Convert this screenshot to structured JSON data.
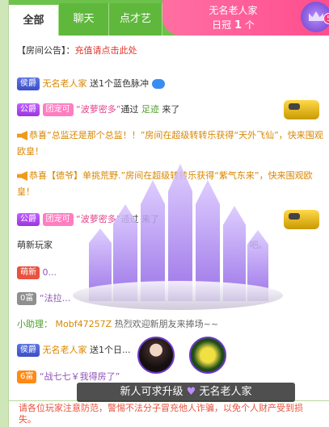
{
  "tabs": [
    "全部",
    "聊天",
    "点才艺"
  ],
  "active_tab": 0,
  "top_box": {
    "name": "无名老人家",
    "rank_prefix": "日冠",
    "rank_num": "1",
    "rank_suffix": "个",
    "level": "5"
  },
  "notice": {
    "label": "【房间公告】：",
    "link": "充值请点击此处"
  },
  "messages": [
    {
      "badge": "侯爵",
      "name": "无名老人家",
      "text": "送1个蓝色脉冲"
    },
    {
      "badge": "公爵",
      "group": "团宠可",
      "name": "“波萝密多”",
      "text": "通过",
      "green": "足迹",
      "tail": "来了"
    },
    {
      "prefix": "恭喜",
      "text": "“总监还是那个总监！！”房间在超级转转乐获得“天外飞仙”，快来围观欧皇！"
    },
    {
      "prefix": "恭喜",
      "name": "【德爷】",
      "name2": "单挑荒野",
      "text": ".”房间在超级转转乐获得“紫气东来”，快来围观欧皇！"
    },
    {
      "badge": "公爵",
      "group": "团宠可",
      "name": "“波萝密多”",
      "text": "通过",
      "tail": "来了"
    },
    {
      "name": "萌新玩家",
      "tail": "吧。"
    },
    {
      "badge": "萌新",
      "text": "0..."
    },
    {
      "badge": "0富",
      "text": "“法拉..."
    },
    {
      "label": "小助理：",
      "name": "Mobf47257Z",
      "text": "热烈欢迎新朋友来捧场~~"
    },
    {
      "badge": "侯爵",
      "name": "无名老人家",
      "text": "送1个日..."
    },
    {
      "badge": "6富",
      "text": "“战七七￥我得房了”"
    }
  ],
  "footer": {
    "text": "新人可求升级",
    "name": "无名老人家"
  },
  "hint": "请各位玩家注意防范，警惕不法分子冒充他人诈骗，以免个人财产受到损失。"
}
